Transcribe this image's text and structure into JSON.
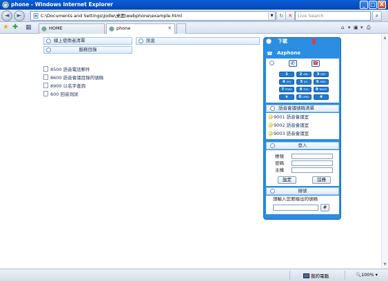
{
  "window": {
    "title": "phone - Windows Internet Explorer",
    "minimize": "_",
    "maximize": "□",
    "close": "X"
  },
  "address_bar": {
    "back": "◄",
    "forward": "►",
    "url": "C:\\Documents and Settings\\Jodie\\桌面\\webphone\\example.html",
    "dropdown": "▼",
    "refresh": "↻",
    "stop": "✕",
    "search_placeholder": "Live Search",
    "search_button": "⌕"
  },
  "tabs_bar": {
    "favorites_star": "★",
    "add_favorite": "✚",
    "tab_list": "▦",
    "tabs": [
      {
        "label": "HOME"
      },
      {
        "label": "phone",
        "close": "✕"
      }
    ],
    "tools": [
      "⌂",
      "▾",
      "▣",
      "▾",
      "⎙"
    ]
  },
  "left_panels": {
    "online_users": "線上使用者清單",
    "service_directory": "服務目錄",
    "services": [
      "8500 語音電話郵件",
      "8600 語音會議目錄的號碼",
      "8900 以名字查詢",
      "600 回音測試"
    ],
    "messages": "訊息"
  },
  "phone": {
    "download_label": "下載",
    "app_name": "Azphone",
    "keys": [
      {
        "d": "1",
        "s": ""
      },
      {
        "d": "2",
        "s": "ABC"
      },
      {
        "d": "3",
        "s": "DEF"
      },
      {
        "d": "4",
        "s": "GHI"
      },
      {
        "d": "5",
        "s": "JKL"
      },
      {
        "d": "6",
        "s": "MNO"
      },
      {
        "d": "7",
        "s": "PQRS"
      },
      {
        "d": "8",
        "s": "TUV"
      },
      {
        "d": "9",
        "s": "WXYZ"
      },
      {
        "d": "★",
        "s": ""
      },
      {
        "d": "0",
        "s": "OPER"
      },
      {
        "d": "#",
        "s": ""
      }
    ],
    "conference_header": "語音會議號碼清單",
    "rooms": [
      "9001 語音會議室",
      "9002 語音會議室",
      "9003 語音會議室"
    ],
    "login_header": "登入",
    "account_label": "帳號",
    "password_label": "密碼",
    "host_label": "主機",
    "settings_button": "設定",
    "register_button": "註冊",
    "dial_header": "撥號",
    "dial_prompt": "請輸入您要撥出的號碼",
    "dial_button": "#"
  },
  "status_bar": {
    "zone": "我的電腦",
    "zoom": "100%"
  },
  "colors": {
    "phone_blue": "#2b8ee0",
    "key_blue": "#1e7ad6",
    "panel_border": "#9ec3e8",
    "title_blue": "#0645b5"
  }
}
